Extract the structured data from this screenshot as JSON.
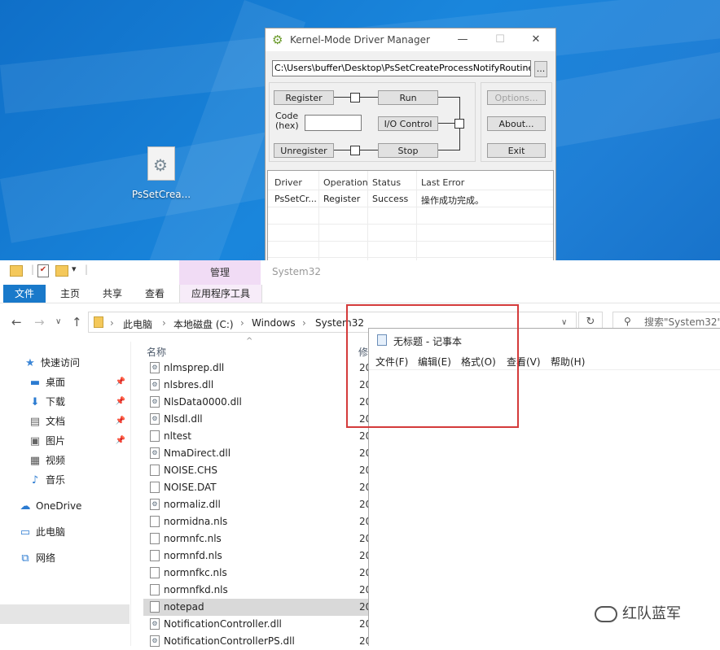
{
  "desktop": {
    "icon_label": "PsSetCrea..."
  },
  "kmdm": {
    "title": "Kernel-Mode Driver Manager",
    "path_value": "C:\\Users\\buffer\\Desktop\\PsSetCreateProcessNotifyRoutineEx.sys",
    "browse_label": "...",
    "register_label": "Register",
    "unregister_label": "Unregister",
    "run_label": "Run",
    "io_control_label": "I/O Control",
    "stop_label": "Stop",
    "code_label_line1": "Code",
    "code_label_line2": "(hex)",
    "code_value": "",
    "options_label": "Options...",
    "about_label": "About...",
    "exit_label": "Exit",
    "list_headers": [
      "Driver",
      "Operation",
      "Status",
      "Last Error"
    ],
    "list_rows": [
      [
        "PsSetCr...",
        "Register",
        "Success",
        "操作成功完成。"
      ]
    ]
  },
  "explorer": {
    "window_title": "System32",
    "context_tab": "管理",
    "tabs": [
      "文件",
      "主页",
      "共享",
      "查看",
      "应用程序工具"
    ],
    "breadcrumbs": [
      "此电脑",
      "本地磁盘 (C:)",
      "Windows",
      "System32"
    ],
    "search_placeholder": "搜索\"System32\"",
    "nav": {
      "quick_access": "快速访问",
      "desktop": "桌面",
      "downloads": "下载",
      "documents": "文档",
      "pictures": "图片",
      "videos": "视频",
      "music": "音乐",
      "onedrive": "OneDrive",
      "this_pc": "此电脑",
      "network": "网络"
    },
    "columns": {
      "name": "名称",
      "modified": "修"
    },
    "files": [
      {
        "name": "nlmsprep.dll",
        "date": "20"
      },
      {
        "name": "nlsbres.dll",
        "date": "20"
      },
      {
        "name": "NlsData0000.dll",
        "date": "20"
      },
      {
        "name": "Nlsdl.dll",
        "date": "20"
      },
      {
        "name": "nltest",
        "date": "20"
      },
      {
        "name": "NmaDirect.dll",
        "date": "20"
      },
      {
        "name": "NOISE.CHS",
        "date": "20"
      },
      {
        "name": "NOISE.DAT",
        "date": "20"
      },
      {
        "name": "normaliz.dll",
        "date": "20"
      },
      {
        "name": "normidna.nls",
        "date": "20"
      },
      {
        "name": "normnfc.nls",
        "date": "20"
      },
      {
        "name": "normnfd.nls",
        "date": "20"
      },
      {
        "name": "normnfkc.nls",
        "date": "20"
      },
      {
        "name": "normnfkd.nls",
        "date": "20"
      },
      {
        "name": "notepad",
        "date": "20",
        "selected": true
      },
      {
        "name": "NotificationController.dll",
        "date": "20"
      },
      {
        "name": "NotificationControllerPS.dll",
        "date": "20"
      }
    ]
  },
  "notepad": {
    "title": "无标题 - 记事本",
    "menu": [
      "文件(F)",
      "编辑(E)",
      "格式(O)",
      "查看(V)",
      "帮助(H)"
    ]
  },
  "watermark": {
    "text": "红队蓝军"
  },
  "colors": {
    "accent": "#1979ca",
    "highlight_box": "#d43b3b",
    "context_tab": "#f1dcf5"
  }
}
